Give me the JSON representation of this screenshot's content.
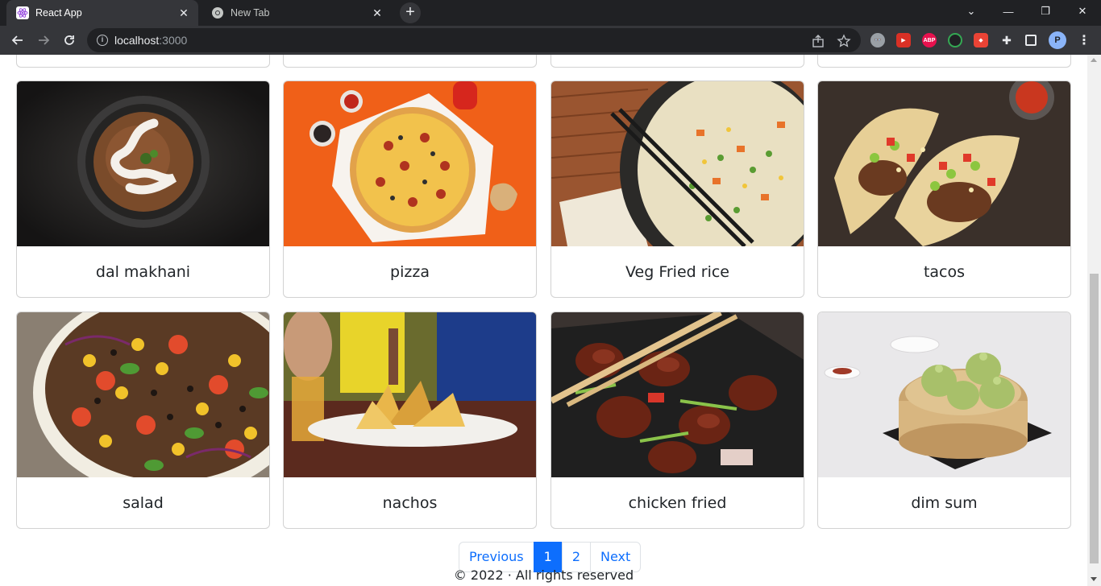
{
  "browser": {
    "tabs": [
      {
        "title": "React App",
        "active": true
      },
      {
        "title": "New Tab",
        "active": false
      }
    ],
    "new_tab_label": "+",
    "address": {
      "host": "localhost",
      "port": ":3000"
    }
  },
  "cards": [
    {
      "name": "dal makhani",
      "image": "dal-makhani-photo"
    },
    {
      "name": "pizza",
      "image": "pizza-photo"
    },
    {
      "name": "Veg Fried rice",
      "image": "veg-fried-rice-photo"
    },
    {
      "name": "tacos",
      "image": "tacos-photo"
    },
    {
      "name": "salad",
      "image": "salad-photo"
    },
    {
      "name": "nachos",
      "image": "nachos-photo"
    },
    {
      "name": "chicken fried",
      "image": "chicken-fried-photo"
    },
    {
      "name": "dim sum",
      "image": "dim-sum-photo"
    }
  ],
  "pagination": {
    "previous": "Previous",
    "pages": [
      "1",
      "2"
    ],
    "current_page": "1",
    "next": "Next"
  },
  "footer": {
    "text": "© 2022 · All rights reserved"
  },
  "colors": {
    "primary": "#0d6efd",
    "chrome_dark": "#202124",
    "chrome_toolbar": "#35363a"
  }
}
